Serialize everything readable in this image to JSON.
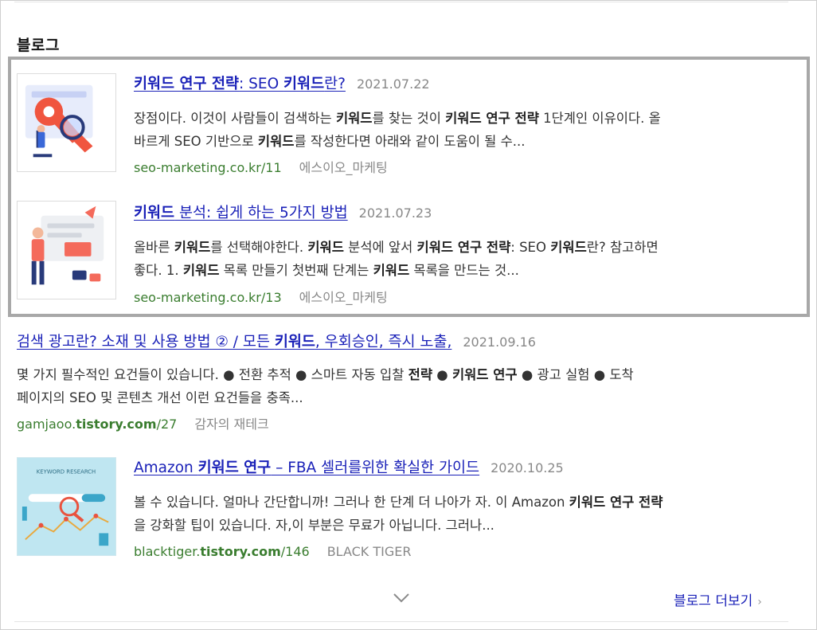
{
  "section": {
    "title": "블로그"
  },
  "results": [
    {
      "title_parts": [
        {
          "t": "키워드 연구 전략",
          "b": true
        },
        {
          "t": ": SEO ",
          "b": false
        },
        {
          "t": "키워드",
          "b": true
        },
        {
          "t": "란?",
          "b": false
        }
      ],
      "date": "2021.07.22",
      "snippet_lines": [
        [
          {
            "t": "장점이다. 이것이 사람들이 검색하는 ",
            "b": false
          },
          {
            "t": "키워드",
            "b": true
          },
          {
            "t": "를 찾는 것이 ",
            "b": false
          },
          {
            "t": "키워드 연구 전략",
            "b": true
          },
          {
            "t": " 1단계인 이유이다. 올",
            "b": false
          }
        ],
        [
          {
            "t": "바르게 SEO 기반으로 ",
            "b": false
          },
          {
            "t": "키워드",
            "b": true
          },
          {
            "t": "를 작성한다면 아래와 같이 도움이 될 수...",
            "b": false
          }
        ]
      ],
      "url_parts": [
        {
          "t": "seo-marketing.co.kr/11",
          "b": false
        }
      ],
      "author": "에스이오_마케팅",
      "thumb_icon": "keyword-research-illustration"
    },
    {
      "title_parts": [
        {
          "t": "키워드",
          "b": true
        },
        {
          "t": " 분석: 쉽게 하는 5가지 방법",
          "b": false
        }
      ],
      "date": "2021.07.23",
      "snippet_lines": [
        [
          {
            "t": "올바른 ",
            "b": false
          },
          {
            "t": "키워드",
            "b": true
          },
          {
            "t": "를 선택해야한다. ",
            "b": false
          },
          {
            "t": "키워드",
            "b": true
          },
          {
            "t": " 분석에 앞서 ",
            "b": false
          },
          {
            "t": "키워드 연구 전략",
            "b": true
          },
          {
            "t": ": SEO ",
            "b": false
          },
          {
            "t": "키워드",
            "b": true
          },
          {
            "t": "란? 참고하면",
            "b": false
          }
        ],
        [
          {
            "t": "좋다. 1. ",
            "b": false
          },
          {
            "t": "키워드",
            "b": true
          },
          {
            "t": " 목록 만들기 첫번째 단계는 ",
            "b": false
          },
          {
            "t": "키워드",
            "b": true
          },
          {
            "t": " 목록을 만드는 것...",
            "b": false
          }
        ]
      ],
      "url_parts": [
        {
          "t": "seo-marketing.co.kr/13",
          "b": false
        }
      ],
      "author": "에스이오_마케팅",
      "thumb_icon": "keyword-analysis-illustration"
    },
    {
      "title_parts": [
        {
          "t": "검색 광고란? 소재 및 사용 방법 ② / 모든 ",
          "b": false
        },
        {
          "t": "키워드",
          "b": true
        },
        {
          "t": ", 우회승인, 즉시 노출,",
          "b": false
        }
      ],
      "date": "2021.09.16",
      "snippet_lines": [
        [
          {
            "t": "몇 가지 필수적인 요건들이 있습니다. ● 전환 추적 ● 스마트 자동 입찰 ",
            "b": false
          },
          {
            "t": "전략",
            "b": true
          },
          {
            "t": " ● ",
            "b": false
          },
          {
            "t": "키워드 연구",
            "b": true
          },
          {
            "t": " ● 광고 실험 ● 도착",
            "b": false
          }
        ],
        [
          {
            "t": "페이지의 SEO 및 콘텐츠 개선 이런 요건들을 충족...",
            "b": false
          }
        ]
      ],
      "url_parts": [
        {
          "t": "gamjaoo.",
          "b": false
        },
        {
          "t": "tistory.com",
          "b": true
        },
        {
          "t": "/27",
          "b": false
        }
      ],
      "author": "감자의 재테크",
      "thumb_icon": ""
    },
    {
      "title_parts": [
        {
          "t": "Amazon ",
          "b": false
        },
        {
          "t": "키워드 연구",
          "b": true
        },
        {
          "t": " – FBA 셀러를위한 확실한 가이드",
          "b": false
        }
      ],
      "date": "2020.10.25",
      "snippet_lines": [
        [
          {
            "t": "볼 수 있습니다. 얼마나 간단합니까! 그러나 한 단계 더 나아가 자. 이 Amazon ",
            "b": false
          },
          {
            "t": "키워드 연구 전략",
            "b": true
          }
        ],
        [
          {
            "t": "을 강화할 팁이 있습니다. 자,이 부분은 무료가 아닙니다. 그러나...",
            "b": false
          }
        ]
      ],
      "url_parts": [
        {
          "t": "blacktiger.",
          "b": false
        },
        {
          "t": "tistory.com",
          "b": true
        },
        {
          "t": "/146",
          "b": false
        }
      ],
      "author": "BLACK TIGER",
      "thumb_icon": "amazon-keyword-research-illustration",
      "thumb_text": "KEYWORD RESEARCH"
    }
  ],
  "footer": {
    "expand_icon": "chevron-down-icon",
    "more_label": "블로그 더보기",
    "more_arrow": "›"
  }
}
